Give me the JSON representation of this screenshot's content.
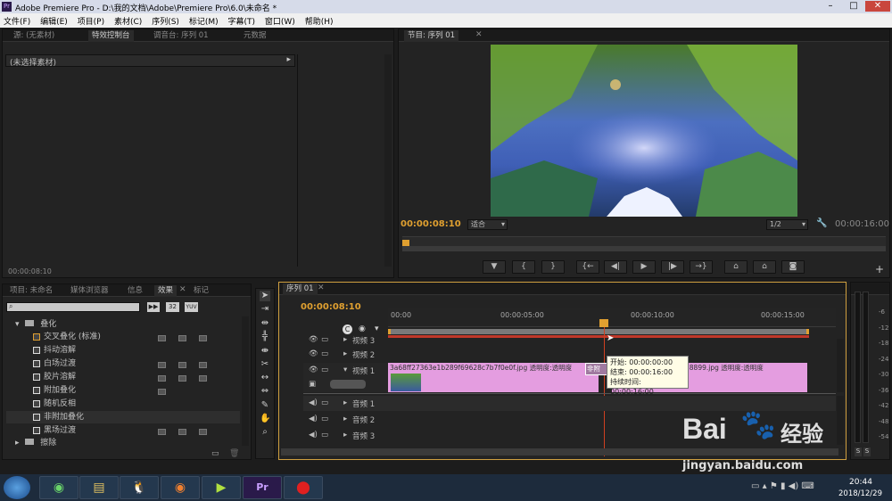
{
  "window": {
    "title": "Adobe Premiere Pro - D:\\我的文档\\Adobe\\Premiere Pro\\6.0\\未命名 *",
    "logo": "Pr"
  },
  "menu": [
    "文件(F)",
    "编辑(E)",
    "项目(P)",
    "素材(C)",
    "序列(S)",
    "标记(M)",
    "字幕(T)",
    "窗口(W)",
    "帮助(H)"
  ],
  "source_panel": {
    "tabs": [
      "源: (无素材)",
      "特效控制台",
      "调音台: 序列 01",
      "元数据"
    ],
    "no_clip": "(未选择素材)",
    "timecode": "00:00:08:10"
  },
  "program": {
    "tab": "节目: 序列 01",
    "timecode": "00:00:08:10",
    "fit": "适合",
    "resolution": "1/2",
    "duration": "00:00:16:00"
  },
  "project_panel": {
    "tabs": [
      "项目: 未命名",
      "媒体浏览器",
      "信息",
      "效果",
      "标记"
    ],
    "search_placeholder": "",
    "fx_badges": [
      "32",
      "YUV"
    ],
    "folder": "叠化",
    "effects": [
      "交叉叠化 (标准)",
      "抖动溶解",
      "白场过渡",
      "胶片溶解",
      "附加叠化",
      "随机反相",
      "非附加叠化",
      "黑场过渡"
    ],
    "folder2": "擦除"
  },
  "timeline": {
    "tab": "序列 01",
    "timecode": "00:00:08:10",
    "ruler": [
      "00:00",
      "00:00:05:00",
      "00:00:10:00",
      "00:00:15:00"
    ],
    "tracks": {
      "video3": "视频 3",
      "video2": "视频 2",
      "video1": "视频 1",
      "audio1": "音频 1",
      "audio2": "音频 2",
      "audio3": "音频 3"
    },
    "clip1_label": "3a68ff27363e1b289f69628c7b7f0e0f.jpg  透明度:透明度",
    "clip_mid_label": "非附",
    "clip2_label": "28899.jpg  透明度:透明度",
    "tooltip": {
      "start": "开始: 00:00:00:00",
      "end": "结束: 00:00:16:00",
      "duration": "持续时间: 00:00:16:00"
    }
  },
  "vu": {
    "ticks": [
      "-6",
      "-12",
      "-18",
      "-24",
      "-30",
      "-36",
      "-42",
      "-48",
      "-54"
    ],
    "solo": [
      "S",
      "S"
    ]
  },
  "watermark": {
    "brand": "Bai",
    "brand2": "经验",
    "url": "jingyan.baidu.com"
  },
  "taskbar": {
    "time": "20:44",
    "date": "2018/12/29"
  }
}
